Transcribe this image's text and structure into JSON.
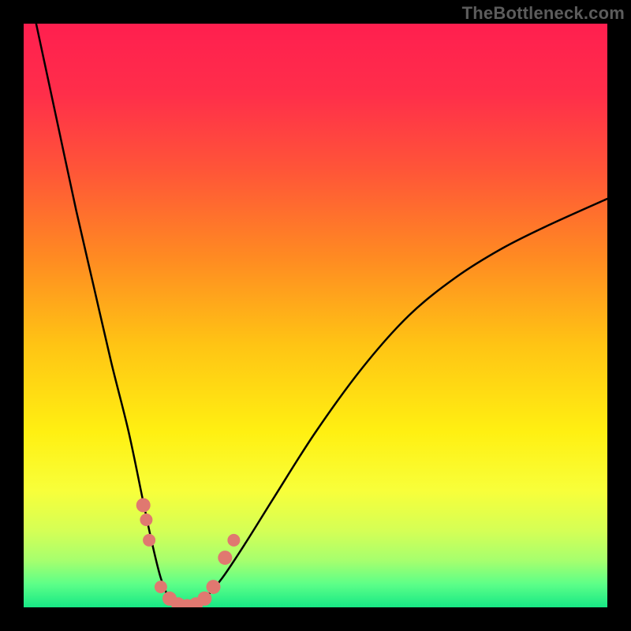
{
  "watermark": "TheBottleneck.com",
  "gradient_stops": [
    {
      "offset": 0.0,
      "color": "#ff1f4f"
    },
    {
      "offset": 0.12,
      "color": "#ff2e4a"
    },
    {
      "offset": 0.25,
      "color": "#ff5538"
    },
    {
      "offset": 0.4,
      "color": "#ff8a22"
    },
    {
      "offset": 0.55,
      "color": "#ffc414"
    },
    {
      "offset": 0.7,
      "color": "#fff012"
    },
    {
      "offset": 0.8,
      "color": "#f8ff3a"
    },
    {
      "offset": 0.87,
      "color": "#d4ff56"
    },
    {
      "offset": 0.92,
      "color": "#a6ff6e"
    },
    {
      "offset": 0.96,
      "color": "#5dff88"
    },
    {
      "offset": 1.0,
      "color": "#17e885"
    }
  ],
  "chart_data": {
    "type": "line",
    "title": "",
    "xlabel": "",
    "ylabel": "",
    "xlim": [
      0,
      1
    ],
    "ylim": [
      0,
      1
    ],
    "series": [
      {
        "name": "bottleneck-curve",
        "x": [
          0.0,
          0.03,
          0.06,
          0.09,
          0.12,
          0.15,
          0.18,
          0.205,
          0.22,
          0.235,
          0.25,
          0.27,
          0.29,
          0.31,
          0.34,
          0.38,
          0.43,
          0.5,
          0.58,
          0.66,
          0.74,
          0.82,
          0.9,
          1.0
        ],
        "y": [
          1.1,
          0.96,
          0.82,
          0.68,
          0.55,
          0.42,
          0.3,
          0.18,
          0.11,
          0.05,
          0.015,
          0.0,
          0.0,
          0.015,
          0.05,
          0.11,
          0.19,
          0.3,
          0.41,
          0.5,
          0.565,
          0.615,
          0.655,
          0.7
        ]
      }
    ],
    "scatter": {
      "name": "highlighted-points",
      "color": "#e07870",
      "points": [
        {
          "x": 0.205,
          "y": 0.175,
          "r": 9
        },
        {
          "x": 0.21,
          "y": 0.15,
          "r": 8
        },
        {
          "x": 0.215,
          "y": 0.115,
          "r": 8
        },
        {
          "x": 0.235,
          "y": 0.035,
          "r": 8
        },
        {
          "x": 0.25,
          "y": 0.015,
          "r": 9
        },
        {
          "x": 0.265,
          "y": 0.005,
          "r": 9
        },
        {
          "x": 0.28,
          "y": 0.002,
          "r": 9
        },
        {
          "x": 0.295,
          "y": 0.005,
          "r": 9
        },
        {
          "x": 0.31,
          "y": 0.015,
          "r": 9
        },
        {
          "x": 0.325,
          "y": 0.035,
          "r": 9
        },
        {
          "x": 0.345,
          "y": 0.085,
          "r": 9
        },
        {
          "x": 0.36,
          "y": 0.115,
          "r": 8
        }
      ]
    }
  }
}
